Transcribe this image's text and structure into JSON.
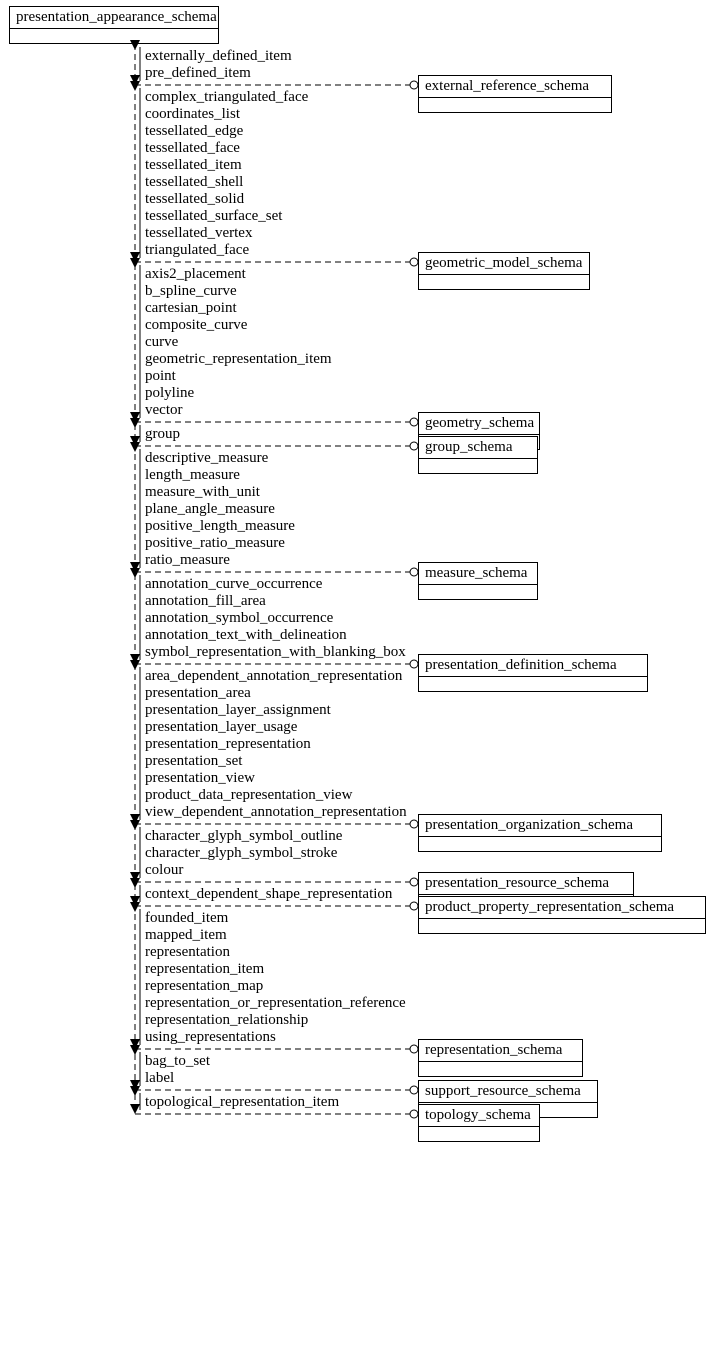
{
  "source_schema": "presentation_appearance_schema",
  "groups": [
    {
      "target": "external_reference_schema",
      "items": [
        "externally_defined_item",
        "pre_defined_item"
      ]
    },
    {
      "target": "geometric_model_schema",
      "items": [
        "complex_triangulated_face",
        "coordinates_list",
        "tessellated_edge",
        "tessellated_face",
        "tessellated_item",
        "tessellated_shell",
        "tessellated_solid",
        "tessellated_surface_set",
        "tessellated_vertex",
        "triangulated_face"
      ]
    },
    {
      "target": "geometry_schema",
      "items": [
        "axis2_placement",
        "b_spline_curve",
        "cartesian_point",
        "composite_curve",
        "curve",
        "geometric_representation_item",
        "point",
        "polyline",
        "vector"
      ]
    },
    {
      "target": "group_schema",
      "items": [
        "group"
      ]
    },
    {
      "target": "measure_schema",
      "items": [
        "descriptive_measure",
        "length_measure",
        "measure_with_unit",
        "plane_angle_measure",
        "positive_length_measure",
        "positive_ratio_measure",
        "ratio_measure"
      ]
    },
    {
      "target": "presentation_definition_schema",
      "items": [
        "annotation_curve_occurrence",
        "annotation_fill_area",
        "annotation_symbol_occurrence",
        "annotation_text_with_delineation",
        "symbol_representation_with_blanking_box"
      ]
    },
    {
      "target": "presentation_organization_schema",
      "items": [
        "area_dependent_annotation_representation",
        "presentation_area",
        "presentation_layer_assignment",
        "presentation_layer_usage",
        "presentation_representation",
        "presentation_set",
        "presentation_view",
        "product_data_representation_view",
        "view_dependent_annotation_representation"
      ]
    },
    {
      "target": "presentation_resource_schema",
      "items": [
        "character_glyph_symbol_outline",
        "character_glyph_symbol_stroke",
        "colour"
      ]
    },
    {
      "target": "product_property_representation_schema",
      "items": [
        "context_dependent_shape_representation"
      ]
    },
    {
      "target": "representation_schema",
      "items": [
        "founded_item",
        "mapped_item",
        "representation",
        "representation_item",
        "representation_map",
        "representation_or_representation_reference",
        "representation_relationship",
        "using_representations"
      ]
    },
    {
      "target": "support_resource_schema",
      "items": [
        "bag_to_set",
        "label"
      ]
    },
    {
      "target": "topology_schema",
      "items": [
        "topological_representation_item"
      ]
    }
  ]
}
